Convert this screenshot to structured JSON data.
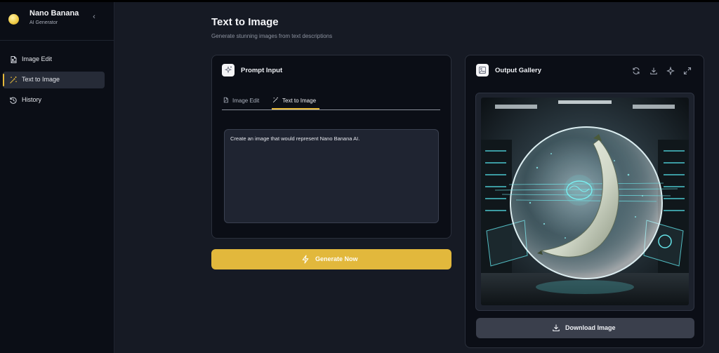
{
  "brand": {
    "title": "Nano Banana",
    "subtitle": "AI Generator"
  },
  "sidebar": {
    "collapse_glyph": "‹",
    "items": [
      {
        "label": "Image Edit",
        "icon": "image-edit-icon",
        "active": false
      },
      {
        "label": "Text to Image",
        "icon": "magic-wand-icon",
        "active": true
      },
      {
        "label": "History",
        "icon": "history-icon",
        "active": false
      }
    ]
  },
  "header": {
    "title": "Text to Image",
    "subtitle": "Generate stunning images from text descriptions"
  },
  "prompt_card": {
    "title": "Prompt Input",
    "tabs": [
      {
        "label": "Image Edit",
        "active": false
      },
      {
        "label": "Text to Image",
        "active": true
      }
    ],
    "prompt_value": "Create an image that would represent Nano Banana AI."
  },
  "generate_button": {
    "label": "Generate Now"
  },
  "gallery_card": {
    "title": "Output Gallery",
    "tools": [
      "refresh-icon",
      "download-icon",
      "sparkle-icon",
      "expand-icon"
    ],
    "download_label": "Download Image"
  },
  "colors": {
    "accent": "#e2b83c",
    "background": "#161a24",
    "sidebar": "#0b0e16",
    "card": "#0b0e16"
  }
}
